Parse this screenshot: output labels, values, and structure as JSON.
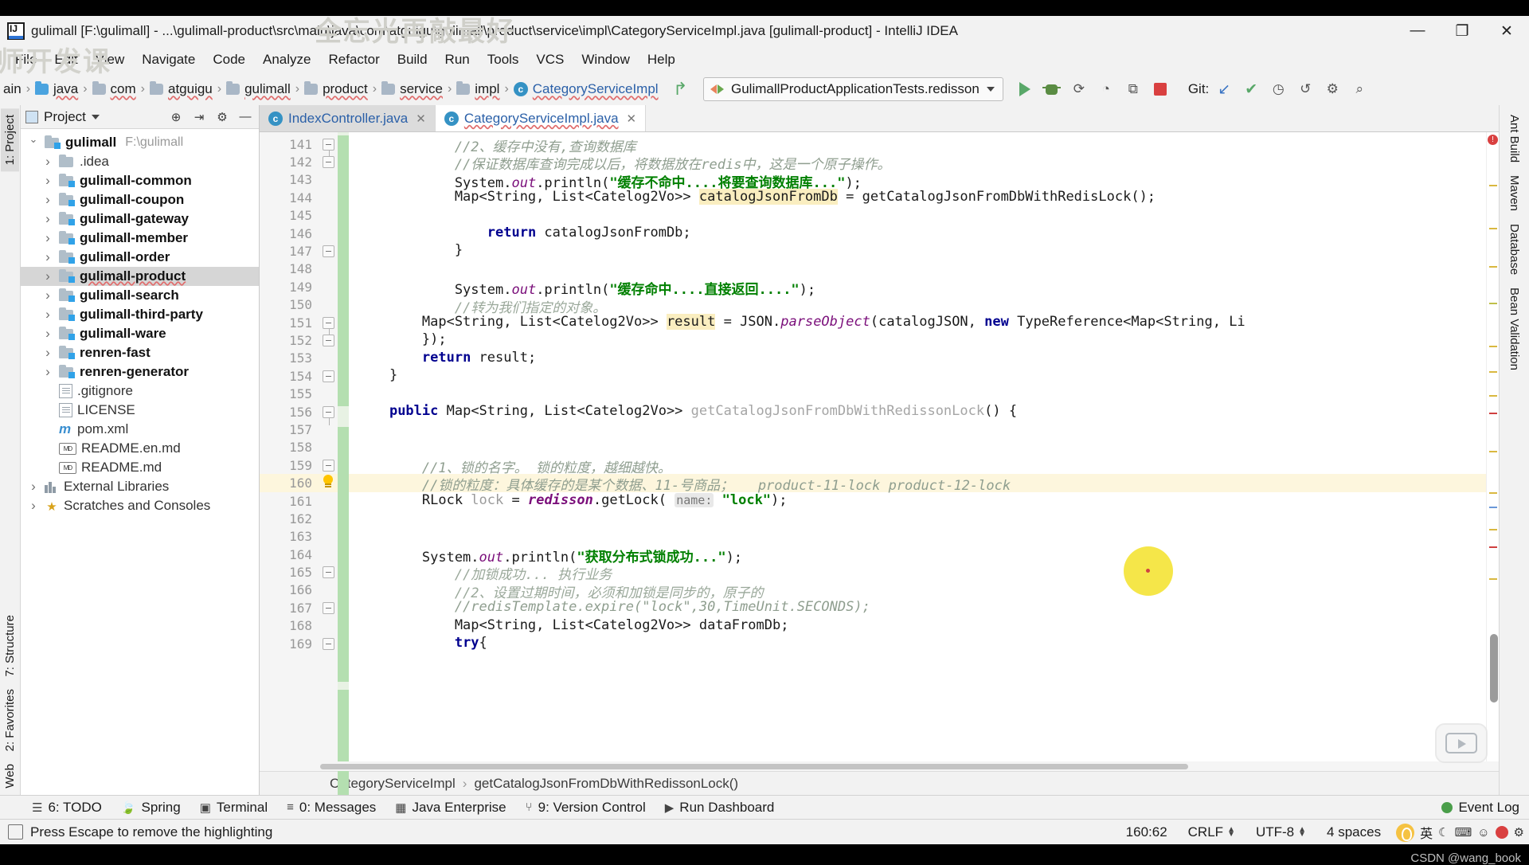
{
  "window": {
    "title": "gulimall [F:\\gulimall] - ...\\gulimall-product\\src\\main\\java\\com\\atguigu\\gulimall\\product\\service\\impl\\CategoryServiceImpl.java [gulimall-product] - IntelliJ IDEA",
    "minimize": "—",
    "maximize": "❐",
    "close": "✕",
    "watermark_1": "全忘光再敲最好",
    "watermark_2": "师开发课"
  },
  "menubar": [
    {
      "label": "File"
    },
    {
      "label": "Edit"
    },
    {
      "label": "View"
    },
    {
      "label": "Navigate"
    },
    {
      "label": "Code"
    },
    {
      "label": "Analyze"
    },
    {
      "label": "Refactor"
    },
    {
      "label": "Build"
    },
    {
      "label": "Run"
    },
    {
      "label": "Tools"
    },
    {
      "label": "VCS"
    },
    {
      "label": "Window"
    },
    {
      "label": "Help"
    }
  ],
  "navbar": {
    "crumbs": [
      {
        "label": "ain",
        "icon": "none"
      },
      {
        "label": "java",
        "icon": "folder-blue"
      },
      {
        "label": "com",
        "icon": "folder"
      },
      {
        "label": "atguigu",
        "icon": "folder"
      },
      {
        "label": "gulimall",
        "icon": "folder"
      },
      {
        "label": "product",
        "icon": "folder"
      },
      {
        "label": "service",
        "icon": "folder"
      },
      {
        "label": "impl",
        "icon": "folder"
      },
      {
        "label": "CategoryServiceImpl",
        "icon": "class"
      }
    ],
    "separator": "›",
    "run_config": "GulimallProductApplicationTests.redisson",
    "git_label": "Git:"
  },
  "project_panel": {
    "title": "Project",
    "tree": [
      {
        "label": "gulimall",
        "path": "F:\\gulimall",
        "icon": "module",
        "indent": 0,
        "twisty": "open",
        "bold": true,
        "selected": false
      },
      {
        "label": ".idea",
        "path": "",
        "icon": "folder-plain",
        "indent": 1,
        "twisty": "closed",
        "bold": false,
        "selected": false
      },
      {
        "label": "gulimall-common",
        "path": "",
        "icon": "module",
        "indent": 1,
        "twisty": "closed",
        "bold": true,
        "selected": false
      },
      {
        "label": "gulimall-coupon",
        "path": "",
        "icon": "module",
        "indent": 1,
        "twisty": "closed",
        "bold": true,
        "selected": false
      },
      {
        "label": "gulimall-gateway",
        "path": "",
        "icon": "module",
        "indent": 1,
        "twisty": "closed",
        "bold": true,
        "selected": false
      },
      {
        "label": "gulimall-member",
        "path": "",
        "icon": "module",
        "indent": 1,
        "twisty": "closed",
        "bold": true,
        "selected": false
      },
      {
        "label": "gulimall-order",
        "path": "",
        "icon": "module",
        "indent": 1,
        "twisty": "closed",
        "bold": true,
        "selected": false
      },
      {
        "label": "gulimall-product",
        "path": "",
        "icon": "module",
        "indent": 1,
        "twisty": "closed",
        "bold": true,
        "selected": true
      },
      {
        "label": "gulimall-search",
        "path": "",
        "icon": "module",
        "indent": 1,
        "twisty": "closed",
        "bold": true,
        "selected": false
      },
      {
        "label": "gulimall-third-party",
        "path": "",
        "icon": "module",
        "indent": 1,
        "twisty": "closed",
        "bold": true,
        "selected": false
      },
      {
        "label": "gulimall-ware",
        "path": "",
        "icon": "module",
        "indent": 1,
        "twisty": "closed",
        "bold": true,
        "selected": false
      },
      {
        "label": "renren-fast",
        "path": "",
        "icon": "module",
        "indent": 1,
        "twisty": "closed",
        "bold": true,
        "selected": false
      },
      {
        "label": "renren-generator",
        "path": "",
        "icon": "module",
        "indent": 1,
        "twisty": "closed",
        "bold": true,
        "selected": false
      },
      {
        "label": ".gitignore",
        "path": "",
        "icon": "file",
        "indent": 1,
        "twisty": "none",
        "bold": false,
        "selected": false
      },
      {
        "label": "LICENSE",
        "path": "",
        "icon": "file",
        "indent": 1,
        "twisty": "none",
        "bold": false,
        "selected": false
      },
      {
        "label": "pom.xml",
        "path": "",
        "icon": "maven",
        "indent": 1,
        "twisty": "none",
        "bold": false,
        "selected": false
      },
      {
        "label": "README.en.md",
        "path": "",
        "icon": "markdown",
        "indent": 1,
        "twisty": "none",
        "bold": false,
        "selected": false
      },
      {
        "label": "README.md",
        "path": "",
        "icon": "markdown",
        "indent": 1,
        "twisty": "none",
        "bold": false,
        "selected": false
      },
      {
        "label": "External Libraries",
        "path": "",
        "icon": "library",
        "indent": 0,
        "twisty": "closed",
        "bold": false,
        "selected": false
      },
      {
        "label": "Scratches and Consoles",
        "path": "",
        "icon": "scratch",
        "indent": 0,
        "twisty": "closed",
        "bold": false,
        "selected": false
      }
    ]
  },
  "left_rail": [
    {
      "label": "1: Project",
      "active": true
    },
    {
      "label": "7: Structure",
      "active": false
    },
    {
      "label": "2: Favorites",
      "active": false
    },
    {
      "label": "Web",
      "active": false
    }
  ],
  "right_rail": [
    {
      "label": "Ant Build"
    },
    {
      "label": "Maven"
    },
    {
      "label": "Database"
    },
    {
      "label": "Bean Validation"
    }
  ],
  "editor": {
    "tabs": [
      {
        "label": "IndexController.java",
        "active": false,
        "wavy": false
      },
      {
        "label": "CategoryServiceImpl.java",
        "active": true,
        "wavy": true
      }
    ],
    "first_line_number": 141,
    "lines": [
      {
        "n": 141,
        "html": "            <span class=\"cmt\">//2、缓存中没有,查询数据库</span>",
        "hl": false
      },
      {
        "n": 142,
        "html": "            <span class=\"cmt\">//保证数据库查询完成以后，将数据放在<i>redis</i>中，这是一个原子操作。</span>",
        "hl": false
      },
      {
        "n": 143,
        "html": "            System.<span class=\"fld\">out</span>.println(<span class=\"str\">\"缓存不命中....将要查询数据库...\"</span>);",
        "hl": false
      },
      {
        "n": 144,
        "html": "            Map&lt;String, List&lt;Catelog2Vo&gt;&gt; <span class=\"hlid\">catalogJsonFromDb</span> = getCatalogJsonFromDbWithRedisLock();",
        "hl": false
      },
      {
        "n": 145,
        "html": "",
        "hl": false
      },
      {
        "n": 146,
        "html": "                <span class=\"kw\">return</span> catalogJsonFromDb;",
        "hl": false
      },
      {
        "n": 147,
        "html": "            }",
        "hl": false
      },
      {
        "n": 148,
        "html": "",
        "hl": false
      },
      {
        "n": 149,
        "html": "            System.<span class=\"fld\">out</span>.println(<span class=\"str\">\"缓存命中....直接返回....\"</span>);",
        "hl": false
      },
      {
        "n": 150,
        "html": "            <span class=\"cmt2\">//转为我们指定的对象。</span>",
        "hl": false
      },
      {
        "n": 151,
        "html": "        Map&lt;String, List&lt;Catelog2Vo&gt;&gt; <span class=\"hlid\">result</span> = JSON.<span class=\"fld\">parseObject</span>(catalogJSON, <span class=\"kw\">new</span> TypeReference&lt;Map&lt;String, Li</span>",
        "hl": false
      },
      {
        "n": 152,
        "html": "        });",
        "hl": false
      },
      {
        "n": 153,
        "html": "        <span class=\"kw\">return</span> result;",
        "hl": false
      },
      {
        "n": 154,
        "html": "    }",
        "hl": false
      },
      {
        "n": 155,
        "html": "",
        "hl": false
      },
      {
        "n": 156,
        "html": "    <span class=\"kw\">public</span> Map&lt;String, List&lt;Catelog2Vo&gt;&gt; <span class=\"ghost\">getCatalogJsonFromDbWithRedissonLock</span>() {",
        "hl": false
      },
      {
        "n": 157,
        "html": "",
        "hl": false
      },
      {
        "n": 158,
        "html": "",
        "hl": false
      },
      {
        "n": 159,
        "html": "        <span class=\"cmt\">//1、锁的名字。 锁的粒度，越细越快。</span>",
        "hl": false
      },
      {
        "n": 160,
        "html": "        <span class=\"cmt\">//锁的粒度：具体缓存的是某个数据、<i>11</i>-号商品；   <i>product-11-lock product-12-lock</i></span>",
        "hl": true
      },
      {
        "n": 161,
        "html": "        RLock <span class=\"gray\">lock</span> = <span class=\"fld\"><b>redisson</b></span>.getLock( <span class=\"param-hint\">name:</span> <span class=\"str\">\"lock\"</span>);",
        "hl": false
      },
      {
        "n": 162,
        "html": "",
        "hl": false
      },
      {
        "n": 163,
        "html": "",
        "hl": false
      },
      {
        "n": 164,
        "html": "        System.<span class=\"fld\">out</span>.println(<span class=\"str\">\"获取分布式锁成功...\"</span>);",
        "hl": false
      },
      {
        "n": 165,
        "html": "            <span class=\"cmt2\">//加锁成功... 执行业务</span>",
        "hl": false
      },
      {
        "n": 166,
        "html": "            <span class=\"cmt2\">//2、设置过期时间，必须和加锁是同步的，原子的</span>",
        "hl": false
      },
      {
        "n": 167,
        "html": "            <span class=\"cmt\">//redisTemplate.expire(\"lock\",30,TimeUnit.SECONDS);</span>",
        "hl": false
      },
      {
        "n": 168,
        "html": "            Map&lt;String, List&lt;Catelog2Vo&gt;&gt; dataFromDb;",
        "hl": false
      },
      {
        "n": 169,
        "html": "            <span class=\"kw\">try</span>{",
        "hl": false
      }
    ],
    "breadcrumb": {
      "class": "CategoryServiceImpl",
      "separator": "›",
      "method": "getCatalogJsonFromDbWithRedissonLock()"
    }
  },
  "tool_windows": [
    {
      "label": "6: TODO",
      "icon": "list-icon"
    },
    {
      "label": "Spring",
      "icon": "leaf-icon"
    },
    {
      "label": "Terminal",
      "icon": "terminal-icon"
    },
    {
      "label": "0: Messages",
      "icon": "messages-icon"
    },
    {
      "label": "Java Enterprise",
      "icon": "java-enterprise-icon"
    },
    {
      "label": "9: Version Control",
      "icon": "version-control-icon"
    },
    {
      "label": "Run Dashboard",
      "icon": "run-dashboard-icon"
    }
  ],
  "event_log": "Event Log",
  "statusbar": {
    "message": "Press Escape to remove the highlighting",
    "caret": "160:62",
    "line_separator": "CRLF",
    "encoding": "UTF-8",
    "indent": "4 spaces",
    "ime_lang": "英",
    "watermark": "CSDN @wang_book"
  },
  "colors": {
    "accent_blue": "#2b60a8",
    "highlight_yellow": "#fdf6dd",
    "marker_green": "#b4dfb0",
    "string_green": "#008000",
    "keyword_navy": "#00008f",
    "dot_yellow": "#f5e642",
    "error_red": "#d94040"
  }
}
